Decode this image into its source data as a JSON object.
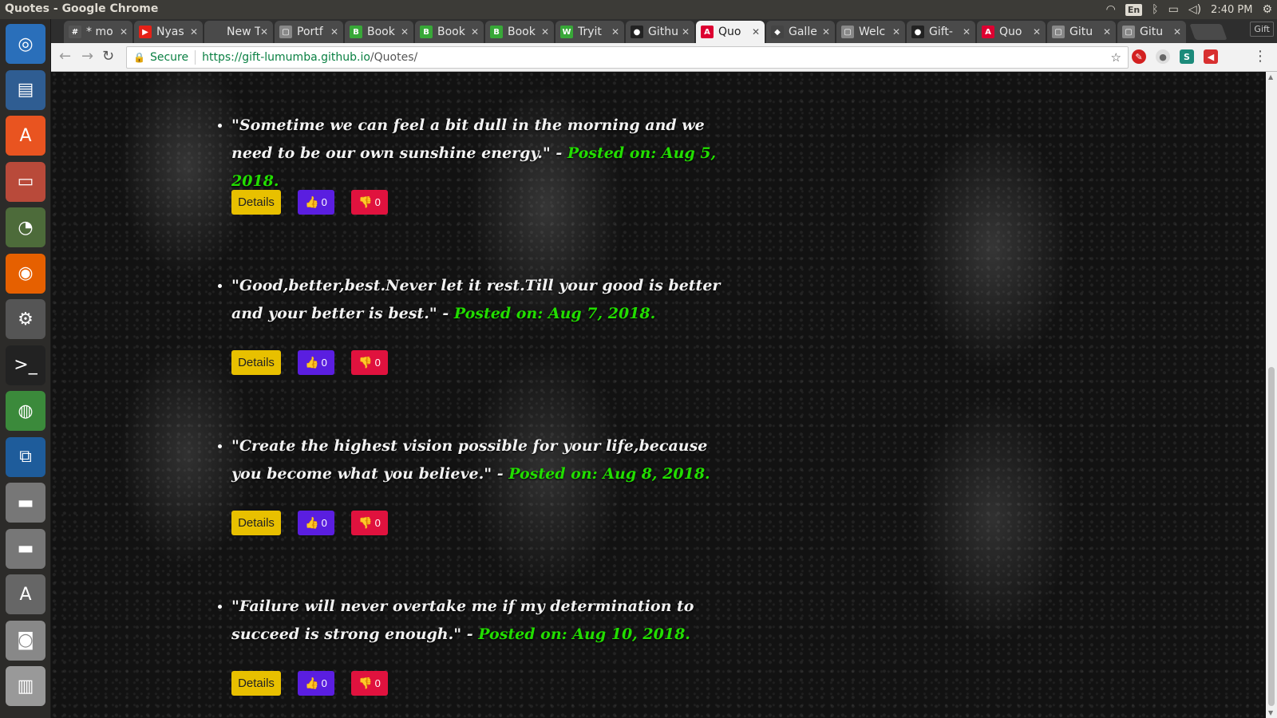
{
  "window": {
    "title": "Quotes - Google Chrome"
  },
  "tray": {
    "lang": "En",
    "time": "2:40 PM"
  },
  "tabs": [
    {
      "label": "* mo",
      "fav": "#",
      "color": "#555"
    },
    {
      "label": "Nyas",
      "fav": "▶",
      "color": "#e62117"
    },
    {
      "label": "New Tab",
      "fav": "",
      "color": "transparent"
    },
    {
      "label": "Portf",
      "fav": "▢",
      "color": "#888"
    },
    {
      "label": "Book",
      "fav": "B",
      "color": "#38a838"
    },
    {
      "label": "Book",
      "fav": "B",
      "color": "#38a838"
    },
    {
      "label": "Book",
      "fav": "B",
      "color": "#38a838"
    },
    {
      "label": "Tryit",
      "fav": "W",
      "color": "#38a838"
    },
    {
      "label": "Githu",
      "fav": "●",
      "color": "#222"
    },
    {
      "label": "Quo",
      "fav": "A",
      "color": "#dd0031"
    },
    {
      "label": "Galle",
      "fav": "◆",
      "color": "#444"
    },
    {
      "label": "Welc",
      "fav": "▢",
      "color": "#888"
    },
    {
      "label": "Gift-",
      "fav": "●",
      "color": "#222"
    },
    {
      "label": "Quo",
      "fav": "A",
      "color": "#dd0031"
    },
    {
      "label": "Gitu",
      "fav": "▢",
      "color": "#888"
    },
    {
      "label": "Gitu",
      "fav": "▢",
      "color": "#888"
    }
  ],
  "profile_label": "Gift",
  "omnibox": {
    "secure": "Secure",
    "host": "https://gift-lumumba.github.io",
    "path": "/Quotes/"
  },
  "quotes": [
    {
      "text": "\"Sometime we can feel a bit dull in the morning and we need to be our own sunshine energy.\" - ",
      "posted": "Posted on: Aug 5, 2018.",
      "details": "Details",
      "up": "0",
      "down": "0"
    },
    {
      "text": "\"Good,better,best.Never let it rest.Till your good is better and your better is best.\" - ",
      "posted": "Posted on: Aug 7, 2018.",
      "details": "Details",
      "up": "0",
      "down": "0"
    },
    {
      "text": "\"Create the highest vision possible for your life,because you become what you believe.\" - ",
      "posted": "Posted on: Aug 8, 2018.",
      "details": "Details",
      "up": "0",
      "down": "0"
    },
    {
      "text": "\"Failure will never overtake me if my determination to succeed is strong enough.\" - ",
      "posted": "Posted on: Aug 10, 2018.",
      "details": "Details",
      "up": "0",
      "down": "0"
    }
  ],
  "launcher": [
    {
      "name": "ubuntu-dash-icon",
      "bg": "#2a6fba",
      "glyph": "◎"
    },
    {
      "name": "writer-icon",
      "bg": "#2f5d92",
      "glyph": "▤"
    },
    {
      "name": "software-center-icon",
      "bg": "#e95420",
      "glyph": "A"
    },
    {
      "name": "files-icon",
      "bg": "#b94a3a",
      "glyph": "▭"
    },
    {
      "name": "disk-usage-icon",
      "bg": "#4d6b3a",
      "glyph": "◔"
    },
    {
      "name": "firefox-icon",
      "bg": "#e66000",
      "glyph": "◉"
    },
    {
      "name": "settings-icon",
      "bg": "#555",
      "glyph": "⚙"
    },
    {
      "name": "terminal-icon",
      "bg": "#222",
      "glyph": ">_"
    },
    {
      "name": "chrome-icon",
      "bg": "#3b8a3b",
      "glyph": "◍"
    },
    {
      "name": "vscode-icon",
      "bg": "#1e5c9b",
      "glyph": "⧉"
    },
    {
      "name": "drive-icon",
      "bg": "#777",
      "glyph": "▬"
    },
    {
      "name": "drive-icon-2",
      "bg": "#777",
      "glyph": "▬"
    },
    {
      "name": "updater-icon",
      "bg": "#666",
      "glyph": "A"
    },
    {
      "name": "camera-icon",
      "bg": "#888",
      "glyph": "◙"
    },
    {
      "name": "trash-icon",
      "bg": "#999",
      "glyph": "▥"
    }
  ]
}
